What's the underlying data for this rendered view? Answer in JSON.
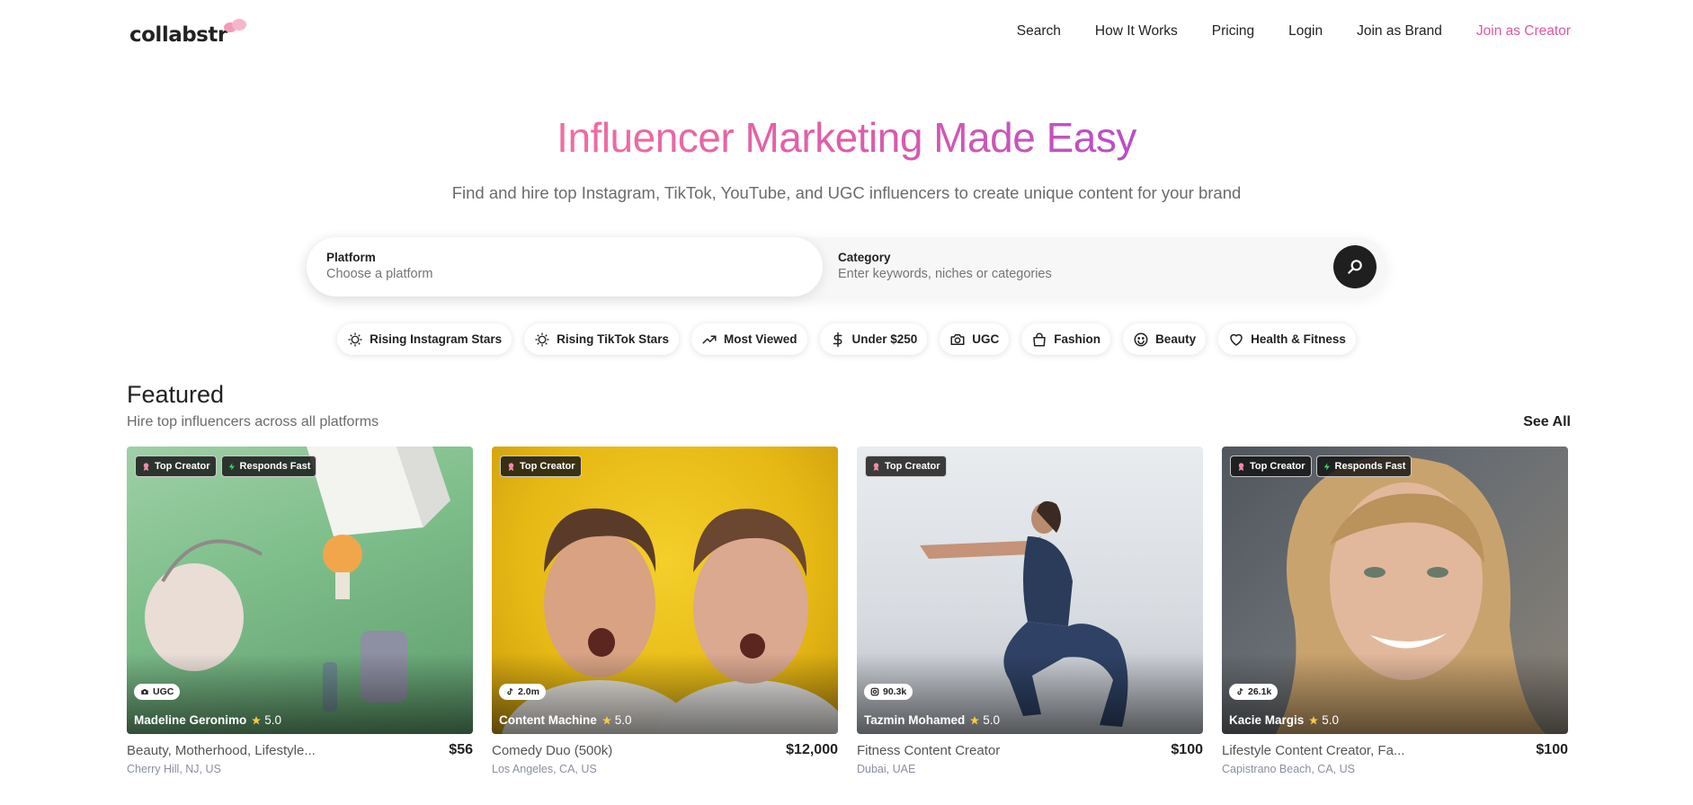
{
  "nav": {
    "logo": "collabstr",
    "links": [
      "Search",
      "How It Works",
      "Pricing",
      "Login",
      "Join as Brand",
      "Join as Creator"
    ]
  },
  "hero": {
    "title": "Influencer Marketing Made Easy",
    "subtitle": "Find and hire top Instagram, TikTok, YouTube, and UGC influencers to create unique content for your brand"
  },
  "search": {
    "platform_label": "Platform",
    "platform_placeholder": "Choose a platform",
    "category_label": "Category",
    "category_placeholder": "Enter keywords, niches or categories"
  },
  "chips": [
    {
      "label": "Rising Instagram Stars",
      "icon": "sparkle-icon"
    },
    {
      "label": "Rising TikTok Stars",
      "icon": "sparkle-icon"
    },
    {
      "label": "Most Viewed",
      "icon": "trending-up-icon"
    },
    {
      "label": "Under $250",
      "icon": "dollar-icon"
    },
    {
      "label": "UGC",
      "icon": "camera-icon"
    },
    {
      "label": "Fashion",
      "icon": "shopping-bag-icon"
    },
    {
      "label": "Beauty",
      "icon": "face-icon"
    },
    {
      "label": "Health & Fitness",
      "icon": "heart-icon"
    }
  ],
  "featured": {
    "title": "Featured",
    "subtitle": "Hire top influencers across all platforms",
    "see_all": "See All",
    "cards": [
      {
        "badges": [
          "Top Creator",
          "Responds Fast"
        ],
        "platform": "UGC",
        "platform_icon": "camera-icon",
        "name": "Madeline Geronimo",
        "rating": "5.0",
        "description": "Beauty, Motherhood, Lifestyle...",
        "price": "$56",
        "location": "Cherry Hill, NJ, US"
      },
      {
        "badges": [
          "Top Creator"
        ],
        "platform": "2.0m",
        "platform_icon": "tiktok-icon",
        "name": "Content Machine",
        "rating": "5.0",
        "description": "Comedy Duo (500k)",
        "price": "$12,000",
        "location": "Los Angeles, CA, US"
      },
      {
        "badges": [
          "Top Creator"
        ],
        "platform": "90.3k",
        "platform_icon": "instagram-icon",
        "name": "Tazmin Mohamed",
        "rating": "5.0",
        "description": "Fitness Content Creator",
        "price": "$100",
        "location": "Dubai, UAE"
      },
      {
        "badges": [
          "Top Creator",
          "Responds Fast"
        ],
        "platform": "26.1k",
        "platform_icon": "tiktok-icon",
        "name": "Kacie Margis",
        "rating": "5.0",
        "description": "Lifestyle Content Creator, Fa...",
        "price": "$100",
        "location": "Capistrano Beach, CA, US"
      }
    ]
  },
  "colors": {
    "accent_pink": "#e2579e",
    "gradient_start": "#ef6fa3",
    "gradient_end": "#b84ec7"
  }
}
